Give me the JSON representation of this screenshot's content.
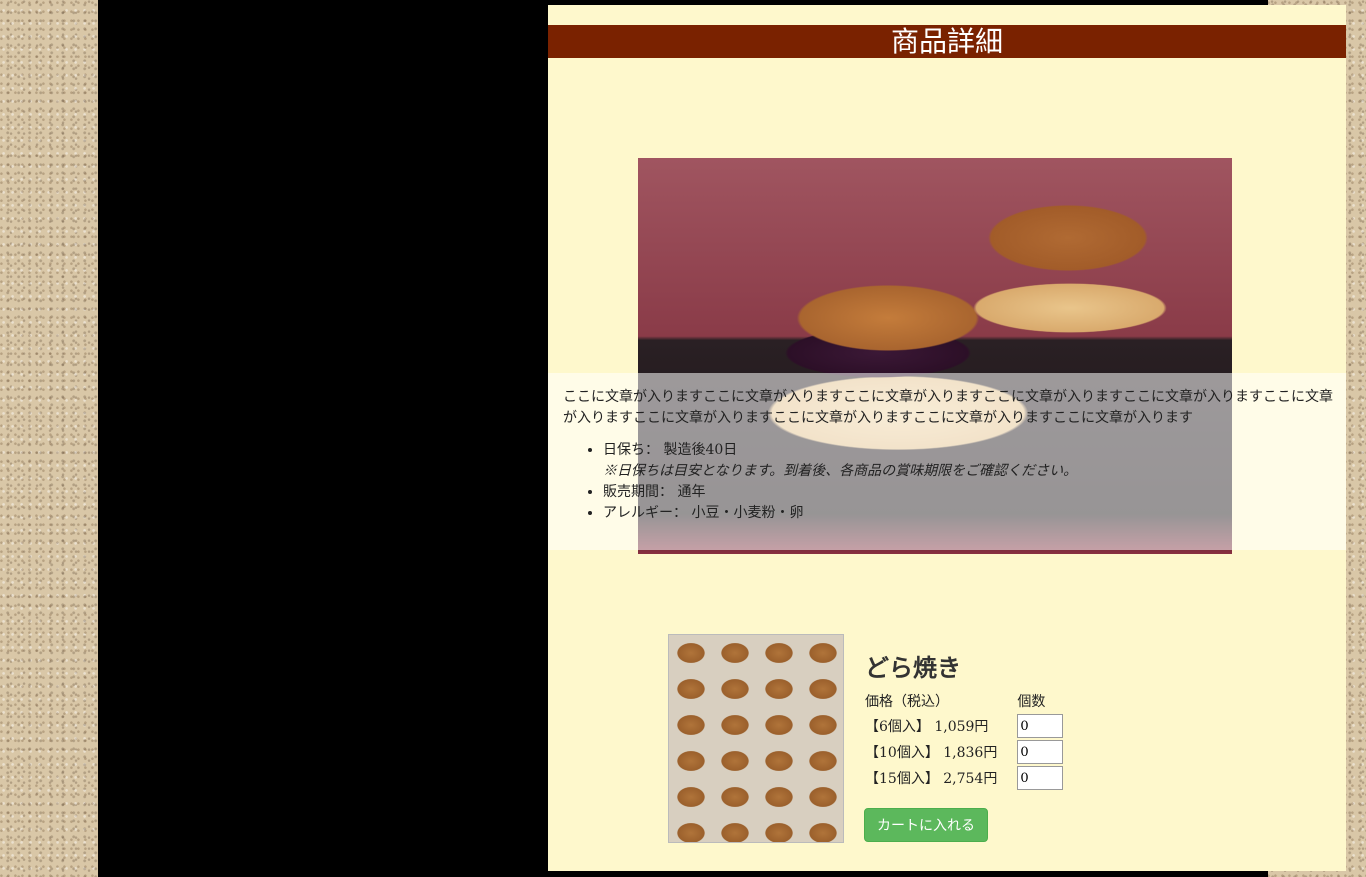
{
  "page": {
    "title": "商品詳細"
  },
  "detail": {
    "description": "ここに文章が入りますここに文章が入りますここに文章が入りますここに文章が入りますここに文章が入りますここに文章が入りますここに文章が入りますここに文章が入りますここに文章が入りますここに文章が入ります",
    "shelf_life_label": "日保ち：",
    "shelf_life_value": "製造後40日",
    "shelf_life_note": "※日保ちは目安となります。到着後、各商品の賞味期限をご確認ください。",
    "sales_period_label": "販売期間：",
    "sales_period_value": "通年",
    "allergy_label": "アレルギー：",
    "allergy_value": "小豆・小麦粉・卵"
  },
  "product": {
    "name": "どら焼き",
    "price_header": "価格（税込）",
    "qty_header": "個数",
    "variants": [
      {
        "label": "【6個入】 1,059円",
        "qty": "0"
      },
      {
        "label": "【10個入】 1,836円",
        "qty": "0"
      },
      {
        "label": "【15個入】 2,754円",
        "qty": "0"
      }
    ],
    "cart_button": "カートに入れる"
  },
  "colors": {
    "title_bar": "#7a2200",
    "panel": "#fef8cc",
    "cart_button": "#5cb85c"
  }
}
